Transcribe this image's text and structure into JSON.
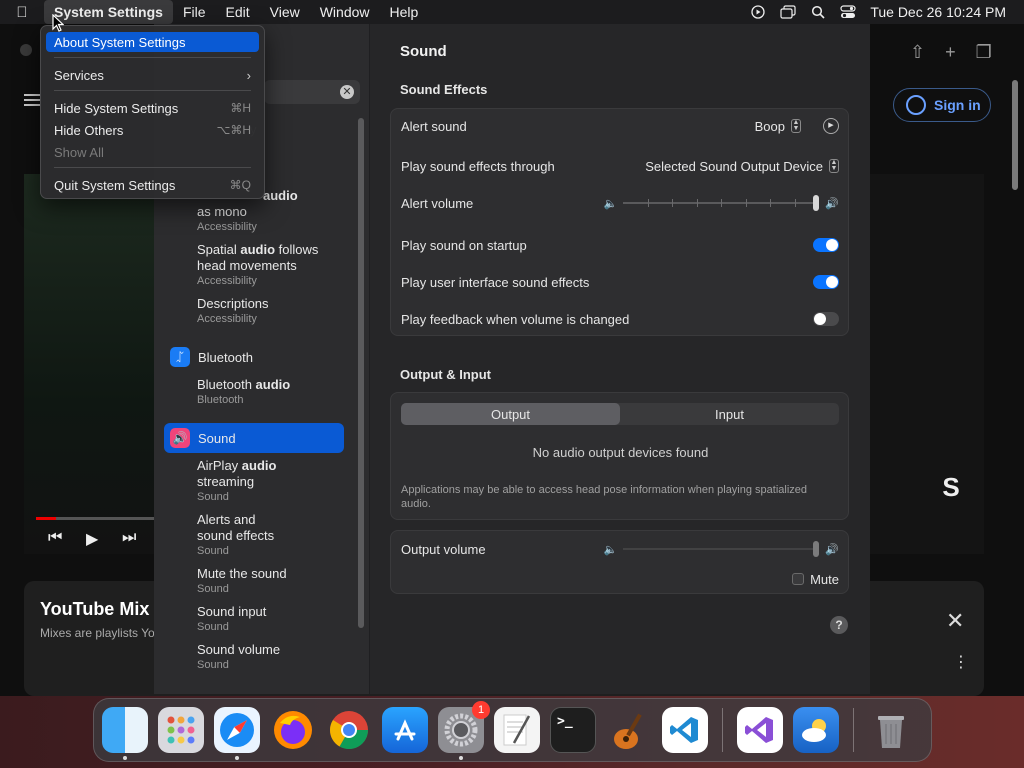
{
  "menubar": {
    "app_name": "System Settings",
    "items": [
      "File",
      "Edit",
      "View",
      "Window",
      "Help"
    ],
    "clock": "Tue Dec 26  10:24 PM"
  },
  "app_menu": {
    "items": [
      {
        "label": "About System Settings",
        "shortcut": "",
        "highlighted": true
      },
      {
        "label": "Services",
        "shortcut": "",
        "submenu": true
      },
      {
        "label": "Hide System Settings",
        "shortcut": "⌘H"
      },
      {
        "label": "Hide Others",
        "shortcut": "⌥⌘H"
      },
      {
        "label": "Show All",
        "shortcut": "",
        "disabled": true
      },
      {
        "label": "Quit System Settings",
        "shortcut": "⌘Q"
      }
    ]
  },
  "browser": {
    "sign_in": "Sign in",
    "yt_title": "YouTube Mix",
    "yt_sub": "Mixes are playlists Yo"
  },
  "sidebar": {
    "results": [
      {
        "pre": "",
        "bold": "audio",
        "post": "",
        "line1": "",
        "line2": "as mono",
        "sub": "Accessibility",
        "partial": "y"
      },
      {
        "pre": "Spatial ",
        "bold": "audio",
        "post": " follows",
        "line2": "head movements",
        "sub": "Accessibility"
      },
      {
        "pre": "Descriptions",
        "bold": "",
        "post": "",
        "line2": "",
        "sub": "Accessibility"
      }
    ],
    "bluetooth_cat": "Bluetooth",
    "bluetooth_items": [
      {
        "pre": "Bluetooth ",
        "bold": "audio",
        "post": "",
        "line2": "",
        "sub": "Bluetooth"
      }
    ],
    "sound_cat": "Sound",
    "sound_items": [
      {
        "pre": "AirPlay ",
        "bold": "audio",
        "post": "",
        "line2": "streaming",
        "sub": "Sound"
      },
      {
        "pre": "Alerts and",
        "bold": "",
        "post": "",
        "line2": "sound effects",
        "sub": "Sound"
      },
      {
        "pre": "Mute the sound",
        "bold": "",
        "post": "",
        "line2": "",
        "sub": "Sound"
      },
      {
        "pre": "Sound input",
        "bold": "",
        "post": "",
        "line2": "",
        "sub": "Sound"
      },
      {
        "pre": "Sound volume",
        "bold": "",
        "post": "",
        "line2": "",
        "sub": "Sound"
      }
    ]
  },
  "main": {
    "title": "Sound",
    "sound_effects": {
      "heading": "Sound Effects",
      "alert_sound_label": "Alert sound",
      "alert_sound_value": "Boop",
      "play_through_label": "Play sound effects through",
      "play_through_value": "Selected Sound Output Device",
      "alert_volume_label": "Alert volume",
      "alert_volume_level": 1.0,
      "startup_label": "Play sound on startup",
      "startup_on": true,
      "ui_sounds_label": "Play user interface sound effects",
      "ui_sounds_on": true,
      "feedback_label": "Play feedback when volume is changed",
      "feedback_on": false
    },
    "output_input": {
      "heading": "Output & Input",
      "tabs": [
        "Output",
        "Input"
      ],
      "selected_tab": 0,
      "no_devices": "No audio output devices found",
      "note": "Applications may be able to access head pose information when playing spatialized audio.",
      "output_volume_label": "Output volume",
      "output_volume_level": 1.0,
      "mute_label": "Mute"
    }
  },
  "dock": {
    "badge_settings": "1"
  },
  "colors": {
    "accent": "#0a5ad4",
    "toggle_on": "#0a74ff",
    "badge": "#ff3b30"
  }
}
